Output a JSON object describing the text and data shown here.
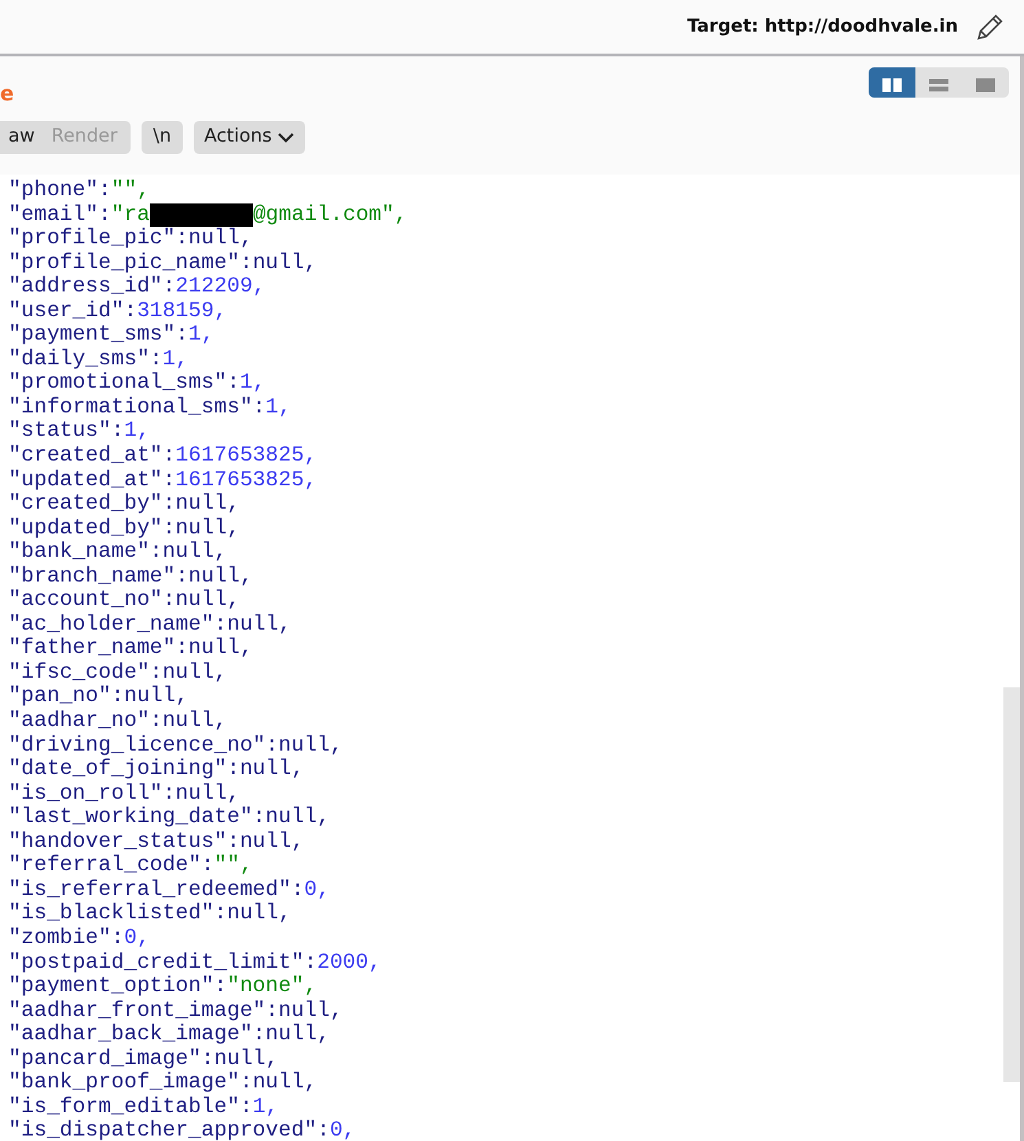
{
  "target": {
    "label": "Target: http://doodhvale.in"
  },
  "view_toggles": [
    {
      "kind": "columns",
      "selected": true
    },
    {
      "kind": "rows",
      "selected": false
    },
    {
      "kind": "single",
      "selected": false
    }
  ],
  "panel_title": "e",
  "view_tabs": [
    {
      "label": "aw",
      "selected": true
    },
    {
      "label": "Render",
      "selected": false
    }
  ],
  "newline_button": "\\n",
  "actions_button": "Actions",
  "lines": [
    {
      "key": "\"phone\":",
      "value": "\"\",",
      "kind": "string"
    },
    {
      "key": "\"email\":",
      "value": "\"ra",
      "redacted": true,
      "value_after": "@gmail.com\",",
      "kind": "string"
    },
    {
      "key": "\"profile_pic\":",
      "value": "null,",
      "kind": "null"
    },
    {
      "key": "\"profile_pic_name\":",
      "value": "null,",
      "kind": "null"
    },
    {
      "key": "\"address_id\":",
      "value": "212209,",
      "kind": "number"
    },
    {
      "key": "\"user_id\":",
      "value": "318159,",
      "kind": "number"
    },
    {
      "key": "\"payment_sms\":",
      "value": "1,",
      "kind": "number"
    },
    {
      "key": "\"daily_sms\":",
      "value": "1,",
      "kind": "number"
    },
    {
      "key": "\"promotional_sms\":",
      "value": "1,",
      "kind": "number"
    },
    {
      "key": "\"informational_sms\":",
      "value": "1,",
      "kind": "number"
    },
    {
      "key": "\"status\":",
      "value": "1,",
      "kind": "number"
    },
    {
      "key": "\"created_at\":",
      "value": "1617653825,",
      "kind": "number"
    },
    {
      "key": "\"updated_at\":",
      "value": "1617653825,",
      "kind": "number"
    },
    {
      "key": "\"created_by\":",
      "value": "null,",
      "kind": "null"
    },
    {
      "key": "\"updated_by\":",
      "value": "null,",
      "kind": "null"
    },
    {
      "key": "\"bank_name\":",
      "value": "null,",
      "kind": "null"
    },
    {
      "key": "\"branch_name\":",
      "value": "null,",
      "kind": "null"
    },
    {
      "key": "\"account_no\":",
      "value": "null,",
      "kind": "null"
    },
    {
      "key": "\"ac_holder_name\":",
      "value": "null,",
      "kind": "null"
    },
    {
      "key": "\"father_name\":",
      "value": "null,",
      "kind": "null"
    },
    {
      "key": "\"ifsc_code\":",
      "value": "null,",
      "kind": "null"
    },
    {
      "key": "\"pan_no\":",
      "value": "null,",
      "kind": "null"
    },
    {
      "key": "\"aadhar_no\":",
      "value": "null,",
      "kind": "null"
    },
    {
      "key": "\"driving_licence_no\":",
      "value": "null,",
      "kind": "null"
    },
    {
      "key": "\"date_of_joining\":",
      "value": "null,",
      "kind": "null"
    },
    {
      "key": "\"is_on_roll\":",
      "value": "null,",
      "kind": "null"
    },
    {
      "key": "\"last_working_date\":",
      "value": "null,",
      "kind": "null"
    },
    {
      "key": "\"handover_status\":",
      "value": "null,",
      "kind": "null"
    },
    {
      "key": "\"referral_code\":",
      "value": "\"\",",
      "kind": "string"
    },
    {
      "key": "\"is_referral_redeemed\":",
      "value": "0,",
      "kind": "number"
    },
    {
      "key": "\"is_blacklisted\":",
      "value": "null,",
      "kind": "null"
    },
    {
      "key": "\"zombie\":",
      "value": "0,",
      "kind": "number"
    },
    {
      "key": "\"postpaid_credit_limit\":",
      "value": "2000,",
      "kind": "number"
    },
    {
      "key": "\"payment_option\":",
      "value": "\"none\",",
      "kind": "string"
    },
    {
      "key": "\"aadhar_front_image\":",
      "value": "null,",
      "kind": "null"
    },
    {
      "key": "\"aadhar_back_image\":",
      "value": "null,",
      "kind": "null"
    },
    {
      "key": "\"pancard_image\":",
      "value": "null,",
      "kind": "null"
    },
    {
      "key": "\"bank_proof_image\":",
      "value": "null,",
      "kind": "null"
    },
    {
      "key": "\"is_form_editable\":",
      "value": "1,",
      "kind": "number"
    },
    {
      "key": "\"is_dispatcher_approved\":",
      "value": "0,",
      "kind": "number"
    }
  ]
}
